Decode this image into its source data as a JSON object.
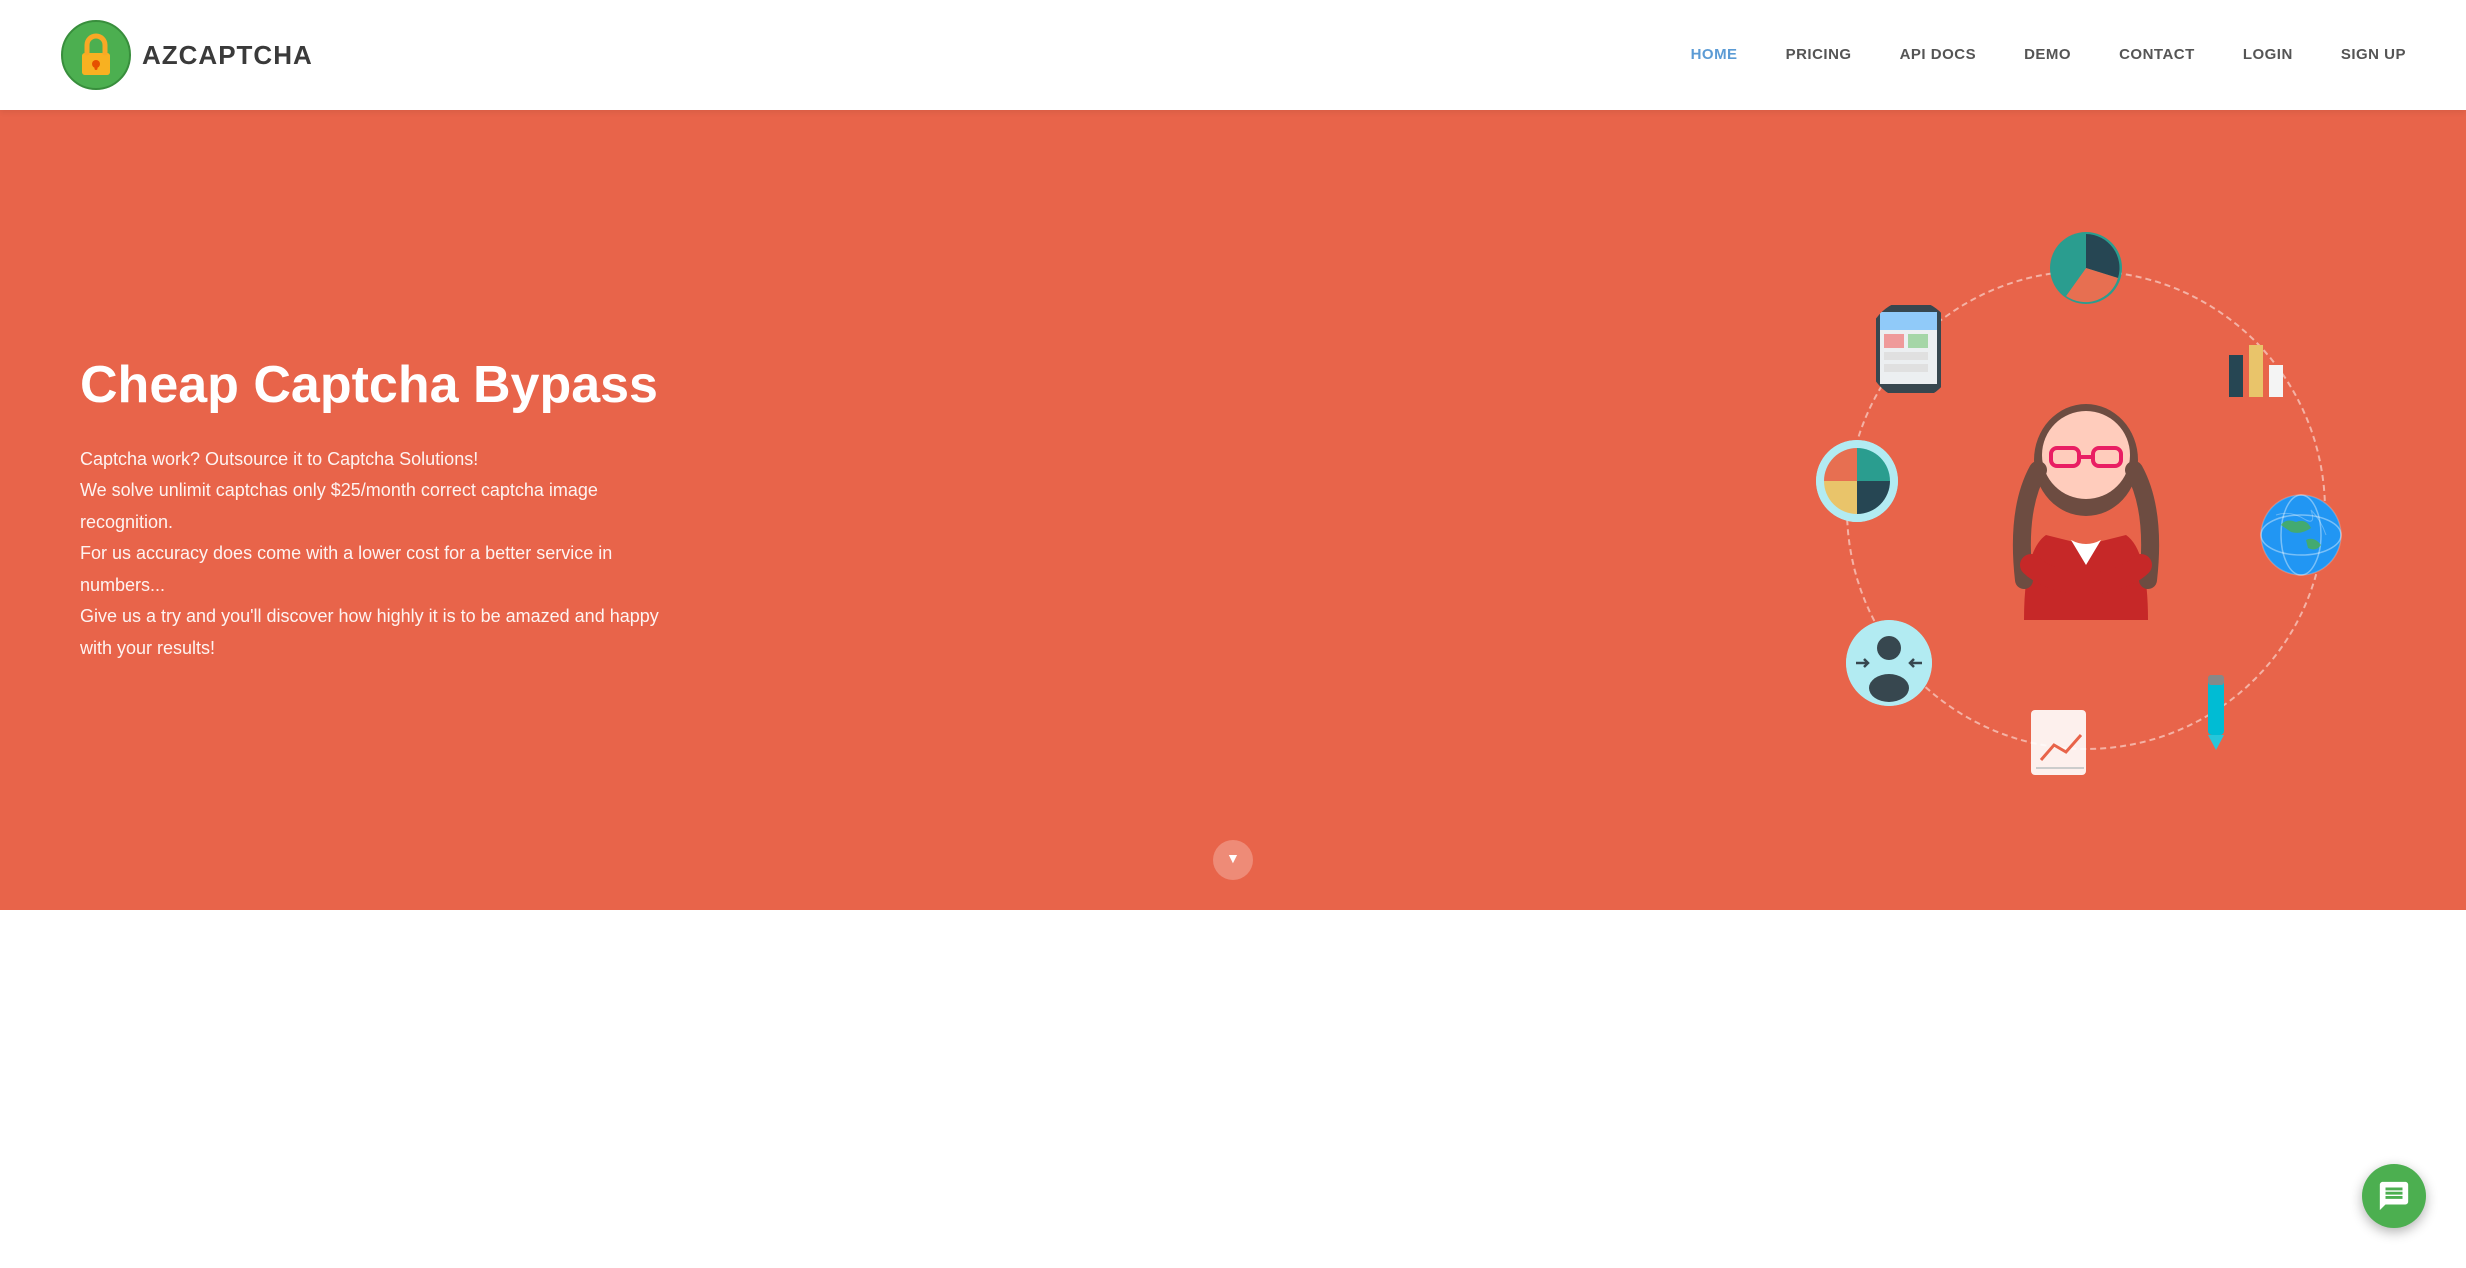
{
  "nav": {
    "logo_text": "AZCAPTCHA",
    "links": [
      {
        "label": "HOME",
        "active": true
      },
      {
        "label": "PRICING",
        "active": false
      },
      {
        "label": "API DOCS",
        "active": false
      },
      {
        "label": "DEMO",
        "active": false
      },
      {
        "label": "CONTACT",
        "active": false
      },
      {
        "label": "LOGIN",
        "active": false
      },
      {
        "label": "SIGN UP",
        "active": false
      }
    ]
  },
  "hero": {
    "title": "Cheap Captcha Bypass",
    "desc_line1": "Captcha work? Outsource it to Captcha Solutions!",
    "desc_line2": "We solve unlimit captchas only $25/month correct captcha image recognition.",
    "desc_line3": "For us accuracy does come with a lower cost for a better service in numbers...",
    "desc_line4": "Give us a try and you'll discover how highly it is to be amazed and happy with your results!"
  },
  "colors": {
    "hero_bg": "#e8644a",
    "nav_active": "#5b9bd5",
    "logo_green": "#4caf50",
    "chat_green": "#4caf50"
  }
}
